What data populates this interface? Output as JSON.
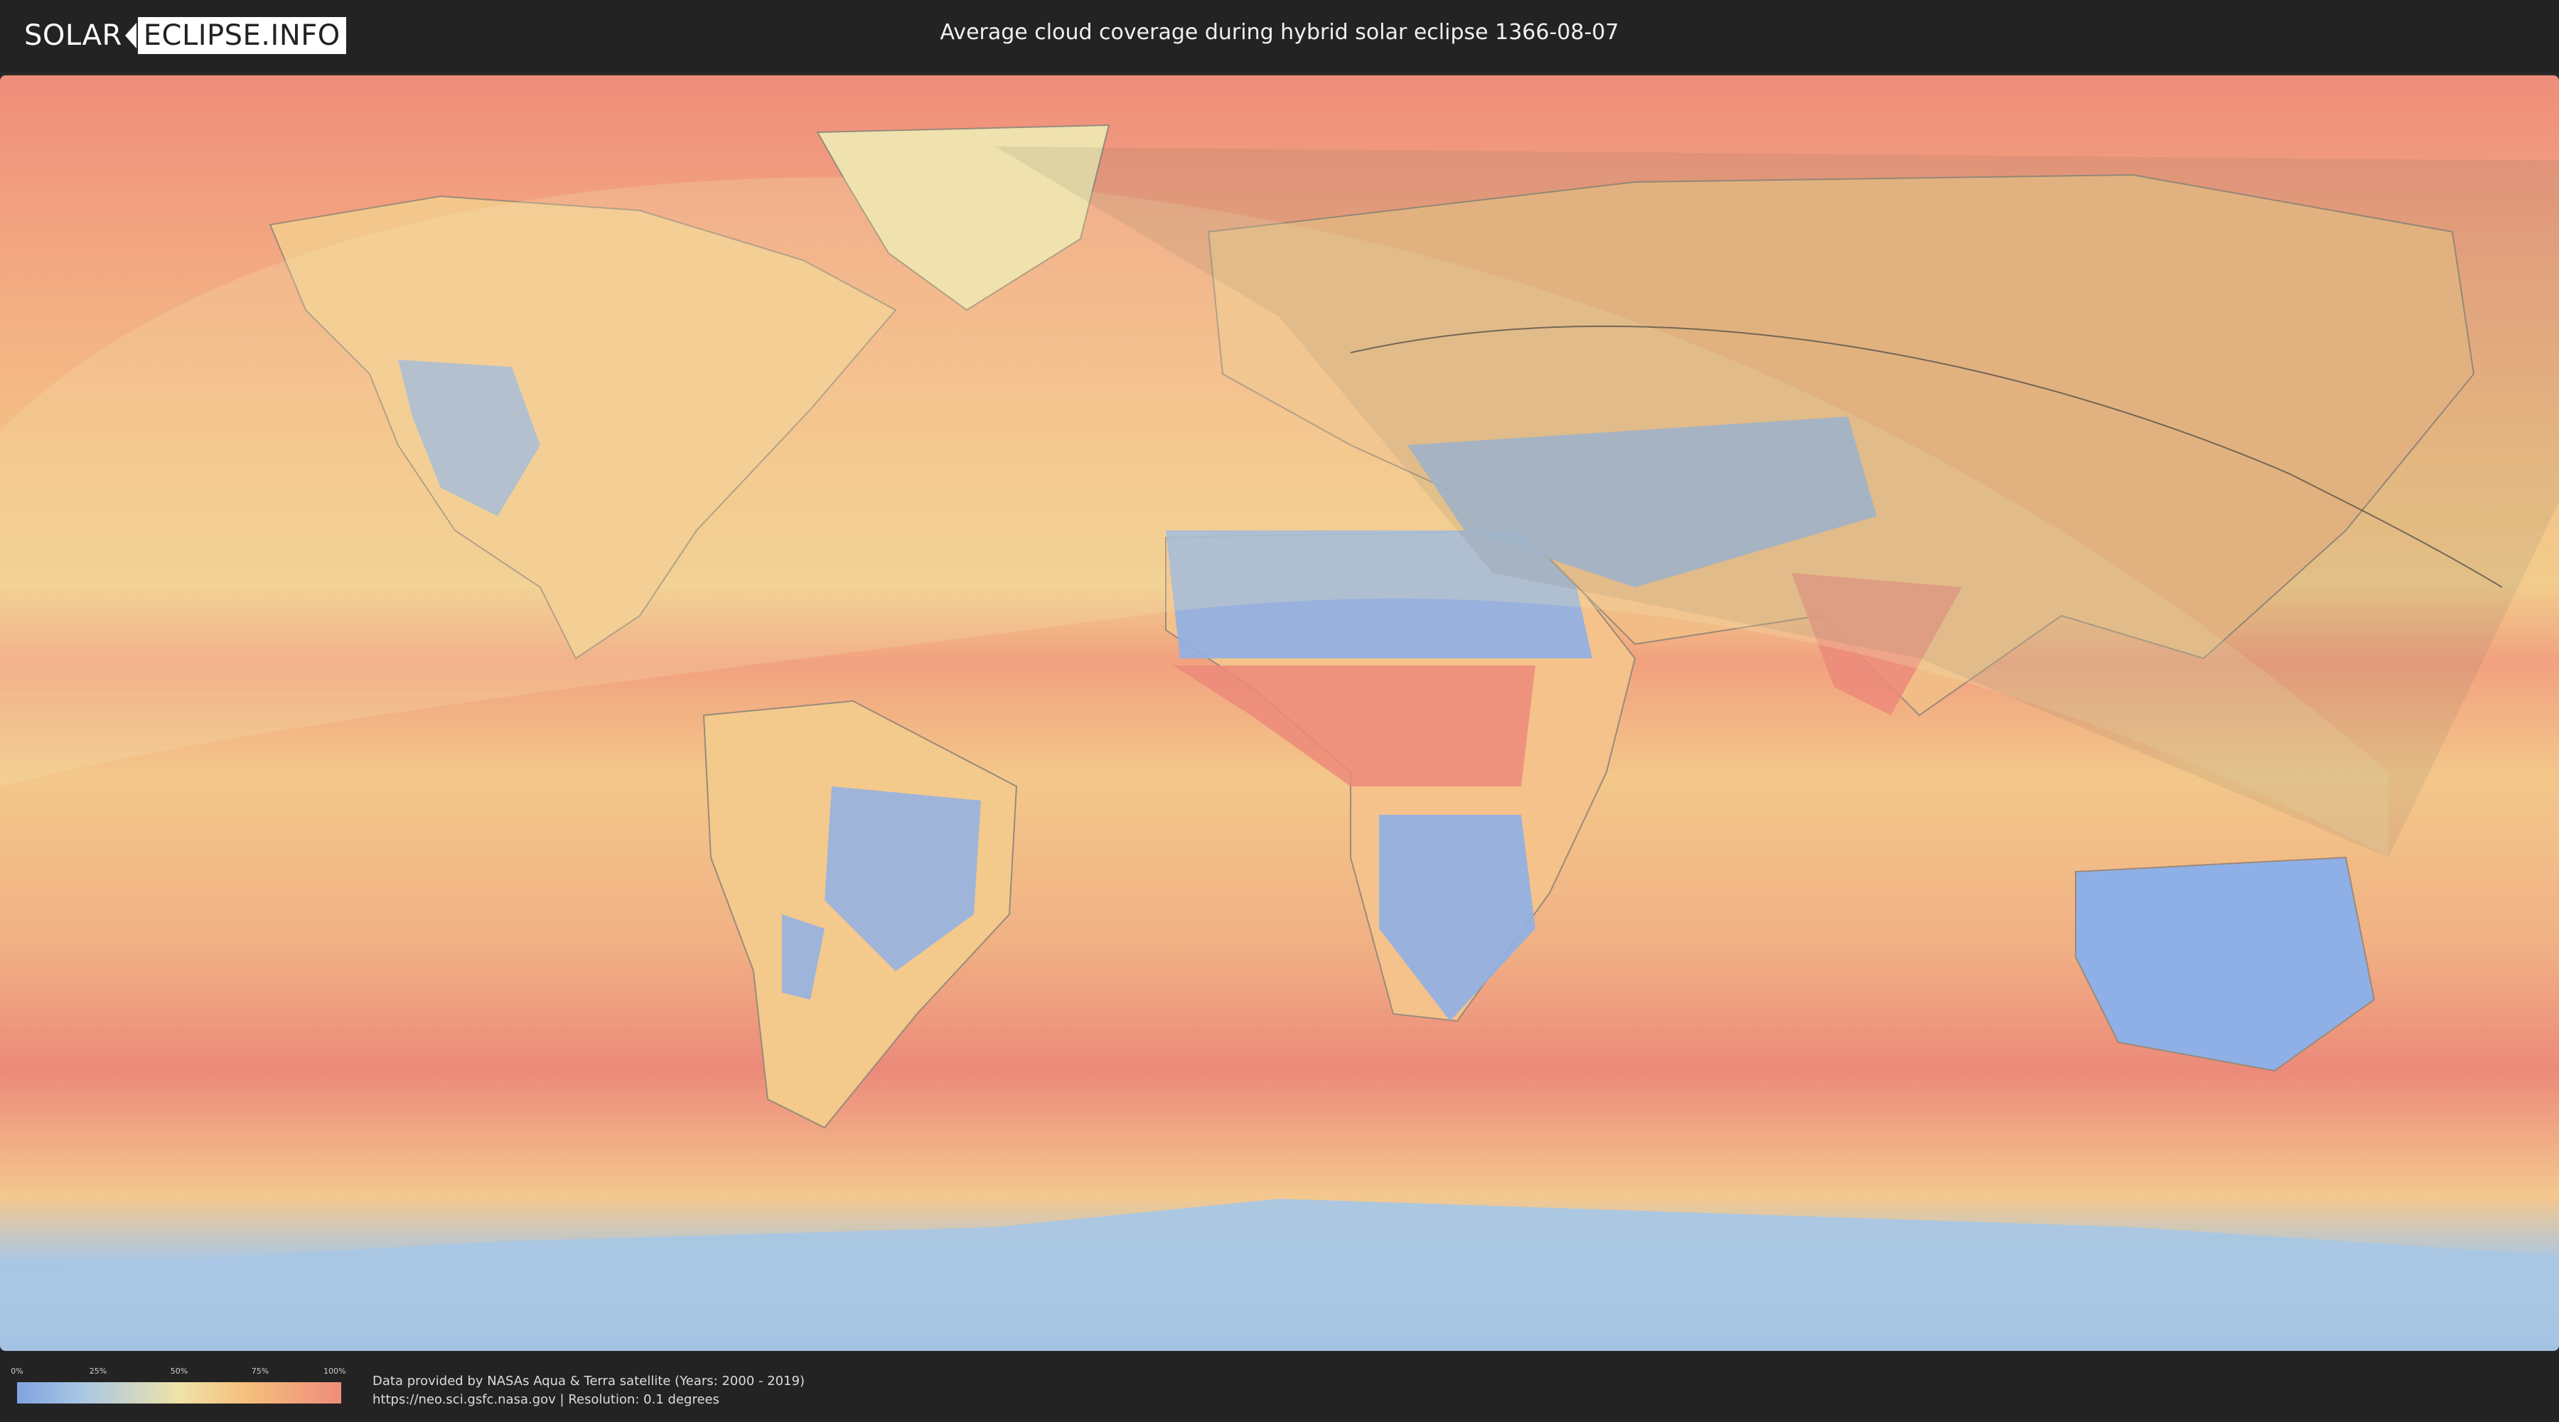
{
  "header": {
    "logo_left": "SOLAR",
    "logo_right": "ECLIPSE.INFO",
    "title": "Average cloud coverage during hybrid solar eclipse 1366-08-07"
  },
  "map": {
    "description_layer": "cloud-coverage",
    "colors": {
      "clear": "#7fa3e0",
      "light": "#a9c7e4",
      "mid": "#eee3a9",
      "heavy": "#f5c07d",
      "overcast": "#ef8d7a"
    }
  },
  "legend": {
    "ticks": [
      "0%",
      "25%",
      "50%",
      "75%",
      "100%"
    ]
  },
  "footer": {
    "source_line1": "Data provided by NASAs Aqua & Terra satellite (Years: 2000 - 2019)",
    "source_line2": "https://neo.sci.gsfc.nasa.gov | Resolution: 0.1 degrees"
  }
}
